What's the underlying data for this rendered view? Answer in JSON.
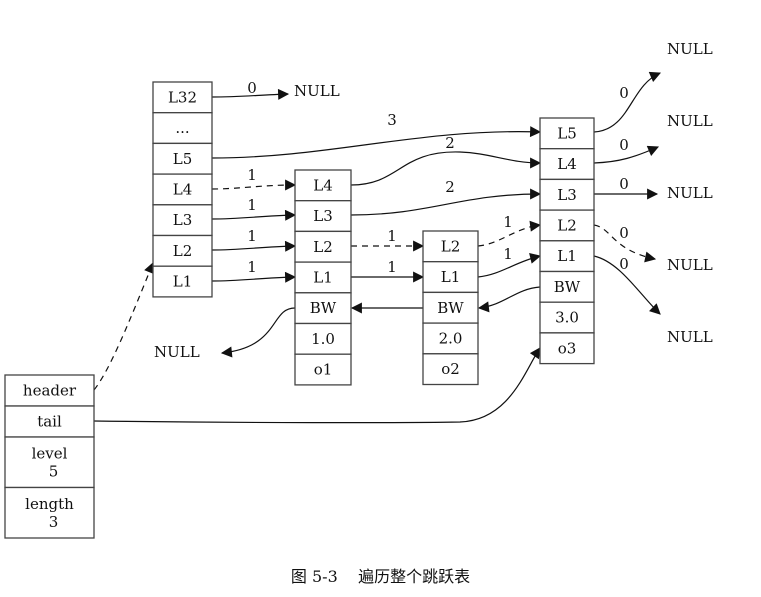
{
  "figure": {
    "caption": "图 5-3    遍历整个跳跃表"
  },
  "list": {
    "fields": [
      {
        "label": "header"
      },
      {
        "label": "tail"
      },
      {
        "label": "level",
        "value": "5"
      },
      {
        "label": "length",
        "value": "3"
      }
    ]
  },
  "header_node": {
    "levels": [
      "L32",
      "...",
      "L5",
      "L4",
      "L3",
      "L2",
      "L1"
    ]
  },
  "nodes": [
    {
      "name": "o1",
      "levels": [
        "L4",
        "L3",
        "L2",
        "L1"
      ],
      "backward": "BW",
      "score": "1.0",
      "obj": "o1"
    },
    {
      "name": "o2",
      "levels": [
        "L2",
        "L1"
      ],
      "backward": "BW",
      "score": "2.0",
      "obj": "o2"
    },
    {
      "name": "o3",
      "levels": [
        "L5",
        "L4",
        "L3",
        "L2",
        "L1"
      ],
      "backward": "BW",
      "score": "3.0",
      "obj": "o3"
    }
  ],
  "null_label": "NULL",
  "edges": [
    {
      "from": "header.L32",
      "to": "NULL",
      "span": "0",
      "dashed": false
    },
    {
      "from": "header.L5",
      "to": "o3.L5",
      "span": "3",
      "dashed": false
    },
    {
      "from": "header.L4",
      "to": "o1.L4",
      "span": "1",
      "dashed": true
    },
    {
      "from": "header.L3",
      "to": "o1.L3",
      "span": "1",
      "dashed": false
    },
    {
      "from": "header.L2",
      "to": "o1.L2",
      "span": "1",
      "dashed": false
    },
    {
      "from": "header.L1",
      "to": "o1.L1",
      "span": "1",
      "dashed": false
    },
    {
      "from": "o1.L4",
      "to": "o3.L4",
      "span": "2",
      "dashed": false
    },
    {
      "from": "o1.L3",
      "to": "o3.L3",
      "span": "2",
      "dashed": false
    },
    {
      "from": "o1.L2",
      "to": "o2.L2",
      "span": "1",
      "dashed": true
    },
    {
      "from": "o1.L1",
      "to": "o2.L1",
      "span": "1",
      "dashed": false
    },
    {
      "from": "o2.L2",
      "to": "o3.L2",
      "span": "1",
      "dashed": true
    },
    {
      "from": "o2.L1",
      "to": "o3.L1",
      "span": "1",
      "dashed": false
    },
    {
      "from": "o3.L5",
      "to": "NULL",
      "span": "0",
      "dashed": false
    },
    {
      "from": "o3.L4",
      "to": "NULL",
      "span": "0",
      "dashed": false
    },
    {
      "from": "o3.L3",
      "to": "NULL",
      "span": "0",
      "dashed": false
    },
    {
      "from": "o3.L2",
      "to": "NULL",
      "span": "0",
      "dashed": true
    },
    {
      "from": "o3.L1",
      "to": "NULL",
      "span": "0",
      "dashed": false
    },
    {
      "from": "o1.BW",
      "to": "NULL",
      "span": "",
      "dashed": false
    },
    {
      "from": "o2.BW",
      "to": "o1.BW",
      "span": "",
      "dashed": false
    },
    {
      "from": "o3.BW",
      "to": "o2.BW",
      "span": "",
      "dashed": false
    },
    {
      "from": "list.header",
      "to": "header_node.L1",
      "span": "",
      "dashed": true
    },
    {
      "from": "list.tail",
      "to": "o3.obj",
      "span": "",
      "dashed": false
    }
  ]
}
